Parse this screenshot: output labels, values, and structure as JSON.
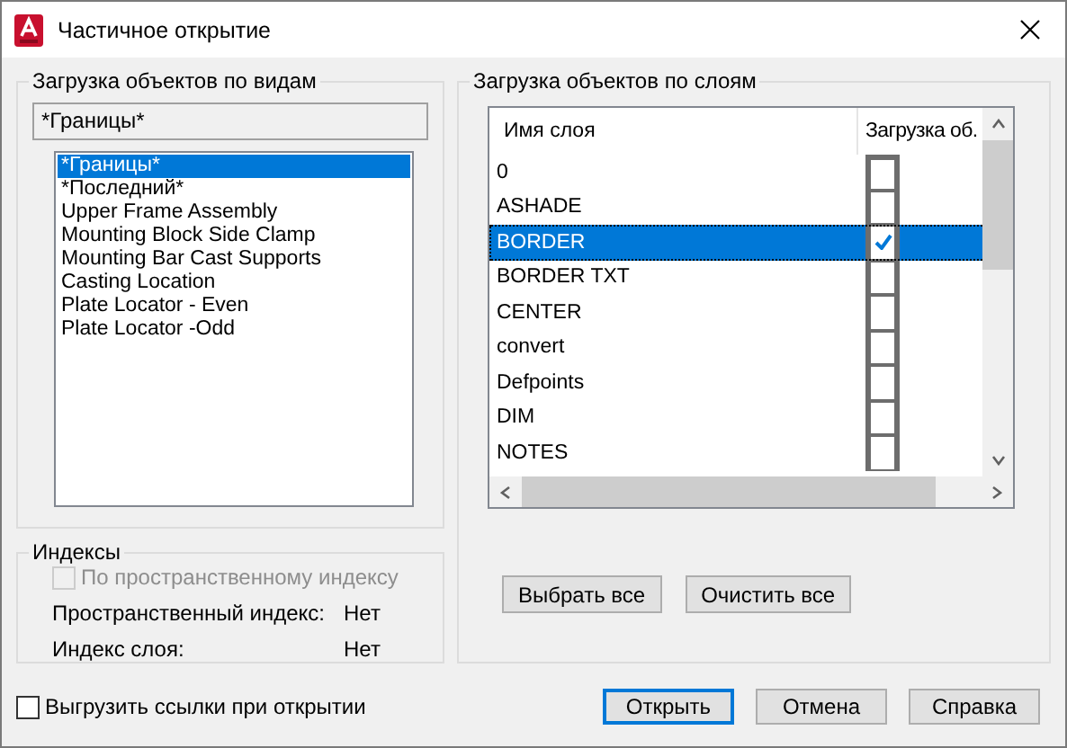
{
  "window": {
    "title": "Частичное открытие"
  },
  "views_group": {
    "title": "Загрузка объектов по видам",
    "current_view": "*Границы*",
    "views": [
      {
        "label": "*Границы*",
        "selected": true
      },
      {
        "label": "*Последний*",
        "selected": false
      },
      {
        "label": "Upper Frame Assembly",
        "selected": false
      },
      {
        "label": "Mounting Block Side Clamp",
        "selected": false
      },
      {
        "label": "Mounting Bar Cast Supports",
        "selected": false
      },
      {
        "label": "Casting Location",
        "selected": false
      },
      {
        "label": "Plate Locator - Even",
        "selected": false
      },
      {
        "label": "Plate Locator -Odd",
        "selected": false
      }
    ]
  },
  "indexes_group": {
    "title": "Индексы",
    "spatial_checkbox": {
      "label": "По пространственному индексу",
      "checked": false,
      "disabled": true
    },
    "info": [
      {
        "label": "Пространственный индекс:",
        "value": "Нет"
      },
      {
        "label": "Индекс слоя:",
        "value": "Нет"
      }
    ]
  },
  "layers_group": {
    "title": "Загрузка объектов по слоям",
    "columns": [
      "Имя слоя",
      "Загрузка об."
    ],
    "rows": [
      {
        "name": "0",
        "checked": false,
        "selected": false
      },
      {
        "name": "ASHADE",
        "checked": false,
        "selected": false
      },
      {
        "name": "BORDER",
        "checked": true,
        "selected": true
      },
      {
        "name": "BORDER TXT",
        "checked": false,
        "selected": false
      },
      {
        "name": "CENTER",
        "checked": false,
        "selected": false
      },
      {
        "name": "convert",
        "checked": false,
        "selected": false
      },
      {
        "name": "Defpoints",
        "checked": false,
        "selected": false
      },
      {
        "name": "DIM",
        "checked": false,
        "selected": false
      },
      {
        "name": "NOTES",
        "checked": false,
        "selected": false
      }
    ],
    "buttons": [
      "Выбрать все",
      "Очистить все"
    ]
  },
  "unload_checkbox": {
    "label": "Выгрузить ссылки при открытии",
    "checked": false
  },
  "buttons": [
    {
      "label": "Открыть",
      "default": true
    },
    {
      "label": "Отмена",
      "default": false
    },
    {
      "label": "Справка",
      "default": false
    }
  ]
}
